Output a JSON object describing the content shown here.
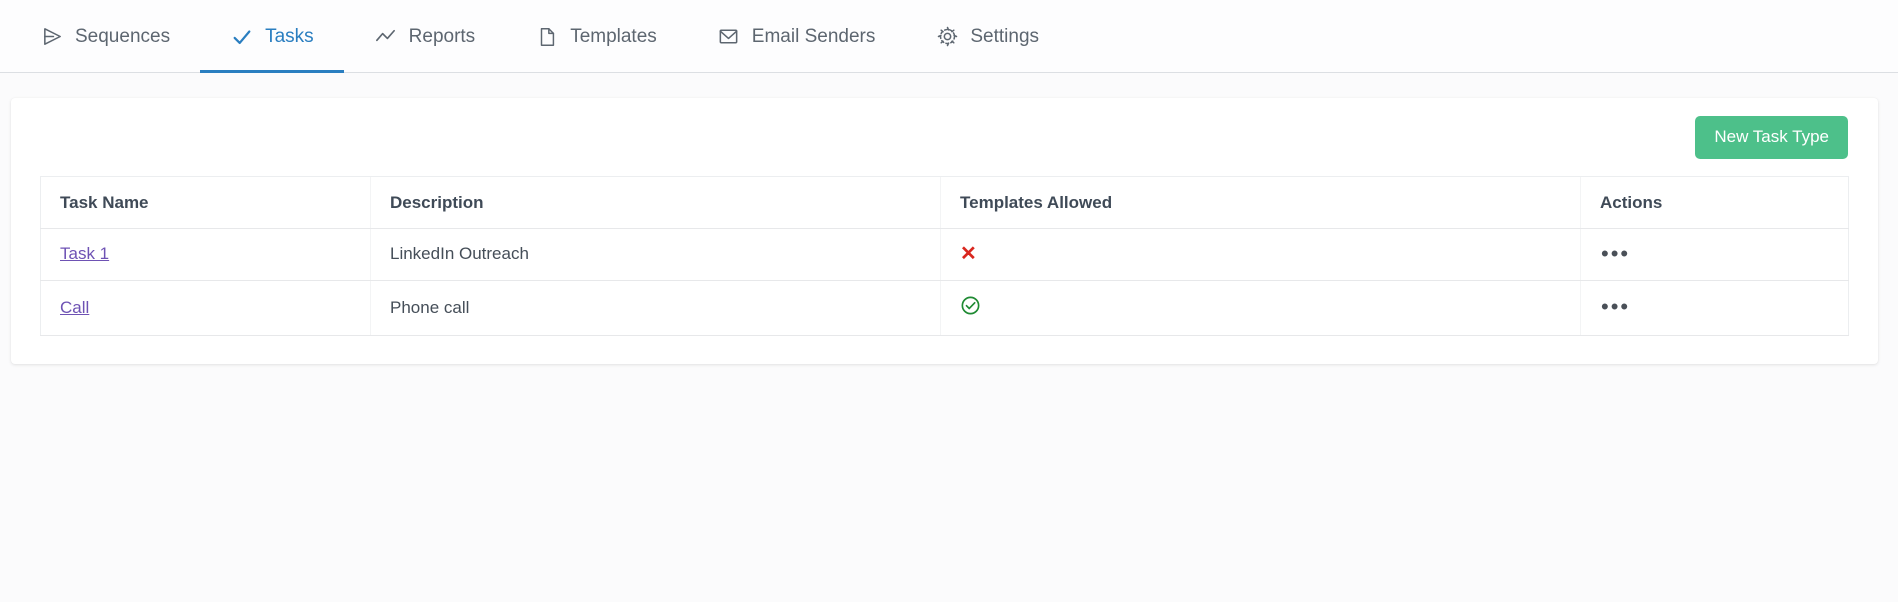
{
  "nav": {
    "items": [
      {
        "label": "Sequences",
        "icon": "paper-plane-icon",
        "active": false
      },
      {
        "label": "Tasks",
        "icon": "check-icon",
        "active": true
      },
      {
        "label": "Reports",
        "icon": "line-chart-icon",
        "active": false
      },
      {
        "label": "Templates",
        "icon": "document-icon",
        "active": false
      },
      {
        "label": "Email Senders",
        "icon": "envelope-icon",
        "active": false
      },
      {
        "label": "Settings",
        "icon": "gear-icon",
        "active": false
      }
    ],
    "active_color": "#2a7ec0",
    "inactive_color": "#5d6670"
  },
  "toolbar": {
    "new_task_type_label": "New Task Type",
    "button_color": "#4dc08a"
  },
  "table": {
    "columns": [
      "Task Name",
      "Description",
      "Templates Allowed",
      "Actions"
    ],
    "rows": [
      {
        "task_name": "Task 1",
        "description": "LinkedIn Outreach",
        "templates_allowed": false,
        "templates_allowed_icon": "red-x-icon",
        "actions_icon": "ellipsis-icon",
        "actions_label": "•••"
      },
      {
        "task_name": "Call",
        "description": "Phone call",
        "templates_allowed": true,
        "templates_allowed_icon": "green-check-circle-icon",
        "actions_icon": "ellipsis-icon",
        "actions_label": "•••"
      }
    ],
    "link_color": "#6e52b4",
    "allowed_true_color": "#1f8a33",
    "allowed_false_color": "#d9271f"
  }
}
